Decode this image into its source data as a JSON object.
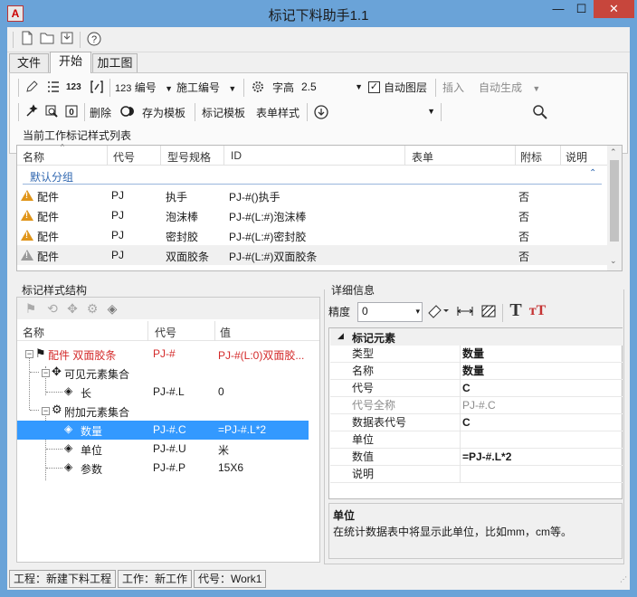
{
  "window": {
    "title": "标记下料助手1.1",
    "app_icon": "A",
    "controls": {
      "minimize": "—",
      "maximize": "☐",
      "close": "✕"
    }
  },
  "quick_access": {
    "icons": [
      "new-file-icon",
      "open-folder-icon",
      "save-icon",
      "help-icon"
    ],
    "help_glyph": "?"
  },
  "tabs": [
    {
      "label": "文件",
      "active": false
    },
    {
      "label": "开始",
      "active": true
    },
    {
      "label": "加工图",
      "active": false
    }
  ],
  "ribbon": {
    "row1": {
      "numbering_label": "编号",
      "numbering_prefix": "123",
      "construction_numbering": "施工编号",
      "font_height_label": "字高",
      "font_height_value": "2.5",
      "auto_layer_label": "自动图层",
      "auto_layer_checked": true,
      "insert_label": "插入",
      "auto_generate_label": "自动生成",
      "small_num_icon_text": "123"
    },
    "row2": {
      "delete_label": "删除",
      "save_template_label": "存为模板",
      "mark_template_label": "标记模板",
      "form_style_label": "表单样式",
      "combo_value": "",
      "search_value": ""
    }
  },
  "style_list": {
    "group_title": "当前工作标记样式列表",
    "columns": [
      "名称",
      "代号",
      "型号规格",
      "ID",
      "表单",
      "附标",
      "说明"
    ],
    "group_name": "默认分组",
    "rows": [
      {
        "name": "配件",
        "code": "PJ",
        "spec": "执手",
        "id": "PJ-#()执手",
        "form": "",
        "attached": "否",
        "note": "",
        "icon": "warning-icon"
      },
      {
        "name": "配件",
        "code": "PJ",
        "spec": "泡沫棒",
        "id": "PJ-#(L:#)泡沫棒",
        "form": "",
        "attached": "否",
        "note": "",
        "icon": "warning-icon"
      },
      {
        "name": "配件",
        "code": "PJ",
        "spec": "密封胶",
        "id": "PJ-#(L:#)密封胶",
        "form": "",
        "attached": "否",
        "note": "",
        "icon": "warning-icon"
      },
      {
        "name": "配件",
        "code": "PJ",
        "spec": "双面胶条",
        "id": "PJ-#(L:#)双面胶条",
        "form": "",
        "attached": "否",
        "note": "",
        "icon": "warning-icon",
        "selected": true
      }
    ]
  },
  "structure": {
    "group_title": "标记样式结构",
    "columns": [
      "名称",
      "代号",
      "值"
    ],
    "nodes": [
      {
        "name": "配件 双面胶条",
        "code": "PJ-#",
        "value": "PJ-#(L:0)双面胶...",
        "level": 0,
        "root": true
      },
      {
        "name": "可见元素集合",
        "code": "",
        "value": "",
        "level": 1
      },
      {
        "name": "长",
        "code": "PJ-#.L",
        "value": "0",
        "level": 2
      },
      {
        "name": "附加元素集合",
        "code": "",
        "value": "",
        "level": 1
      },
      {
        "name": "数量",
        "code": "PJ-#.C",
        "value": "=PJ-#.L*2",
        "level": 2,
        "selected": true
      },
      {
        "name": "单位",
        "code": "PJ-#.U",
        "value": "米",
        "level": 2
      },
      {
        "name": "参数",
        "code": "PJ-#.P",
        "value": "15X6",
        "level": 2
      }
    ]
  },
  "details": {
    "group_title": "详细信息",
    "precision_label": "精度",
    "precision_value": "0",
    "section": "标记元素",
    "props": [
      {
        "key": "类型",
        "value": "数量",
        "disabled": false
      },
      {
        "key": "名称",
        "value": "数量",
        "disabled": false
      },
      {
        "key": "代号",
        "value": "C",
        "disabled": false
      },
      {
        "key": "代号全称",
        "value": "PJ-#.C",
        "disabled": true
      },
      {
        "key": "数据表代号",
        "value": "C",
        "disabled": false
      },
      {
        "key": "单位",
        "value": "",
        "disabled": false
      },
      {
        "key": "数值",
        "value": "=PJ-#.L*2",
        "disabled": false
      },
      {
        "key": "说明",
        "value": "",
        "disabled": false
      }
    ],
    "desc_title": "单位",
    "desc_text": "在统计数据表中将显示此单位，比如mm，cm等。"
  },
  "statusbar": {
    "project": "工程：新建下料工程",
    "work": "工作：新工作",
    "code": "代号：Work1"
  },
  "colors": {
    "titlebar": "#6aa3d8",
    "close": "#c7463c",
    "selection": "#3399ff",
    "root_red": "#d42a2a",
    "warning": "#e0951a",
    "group_blue": "#3067b0"
  }
}
